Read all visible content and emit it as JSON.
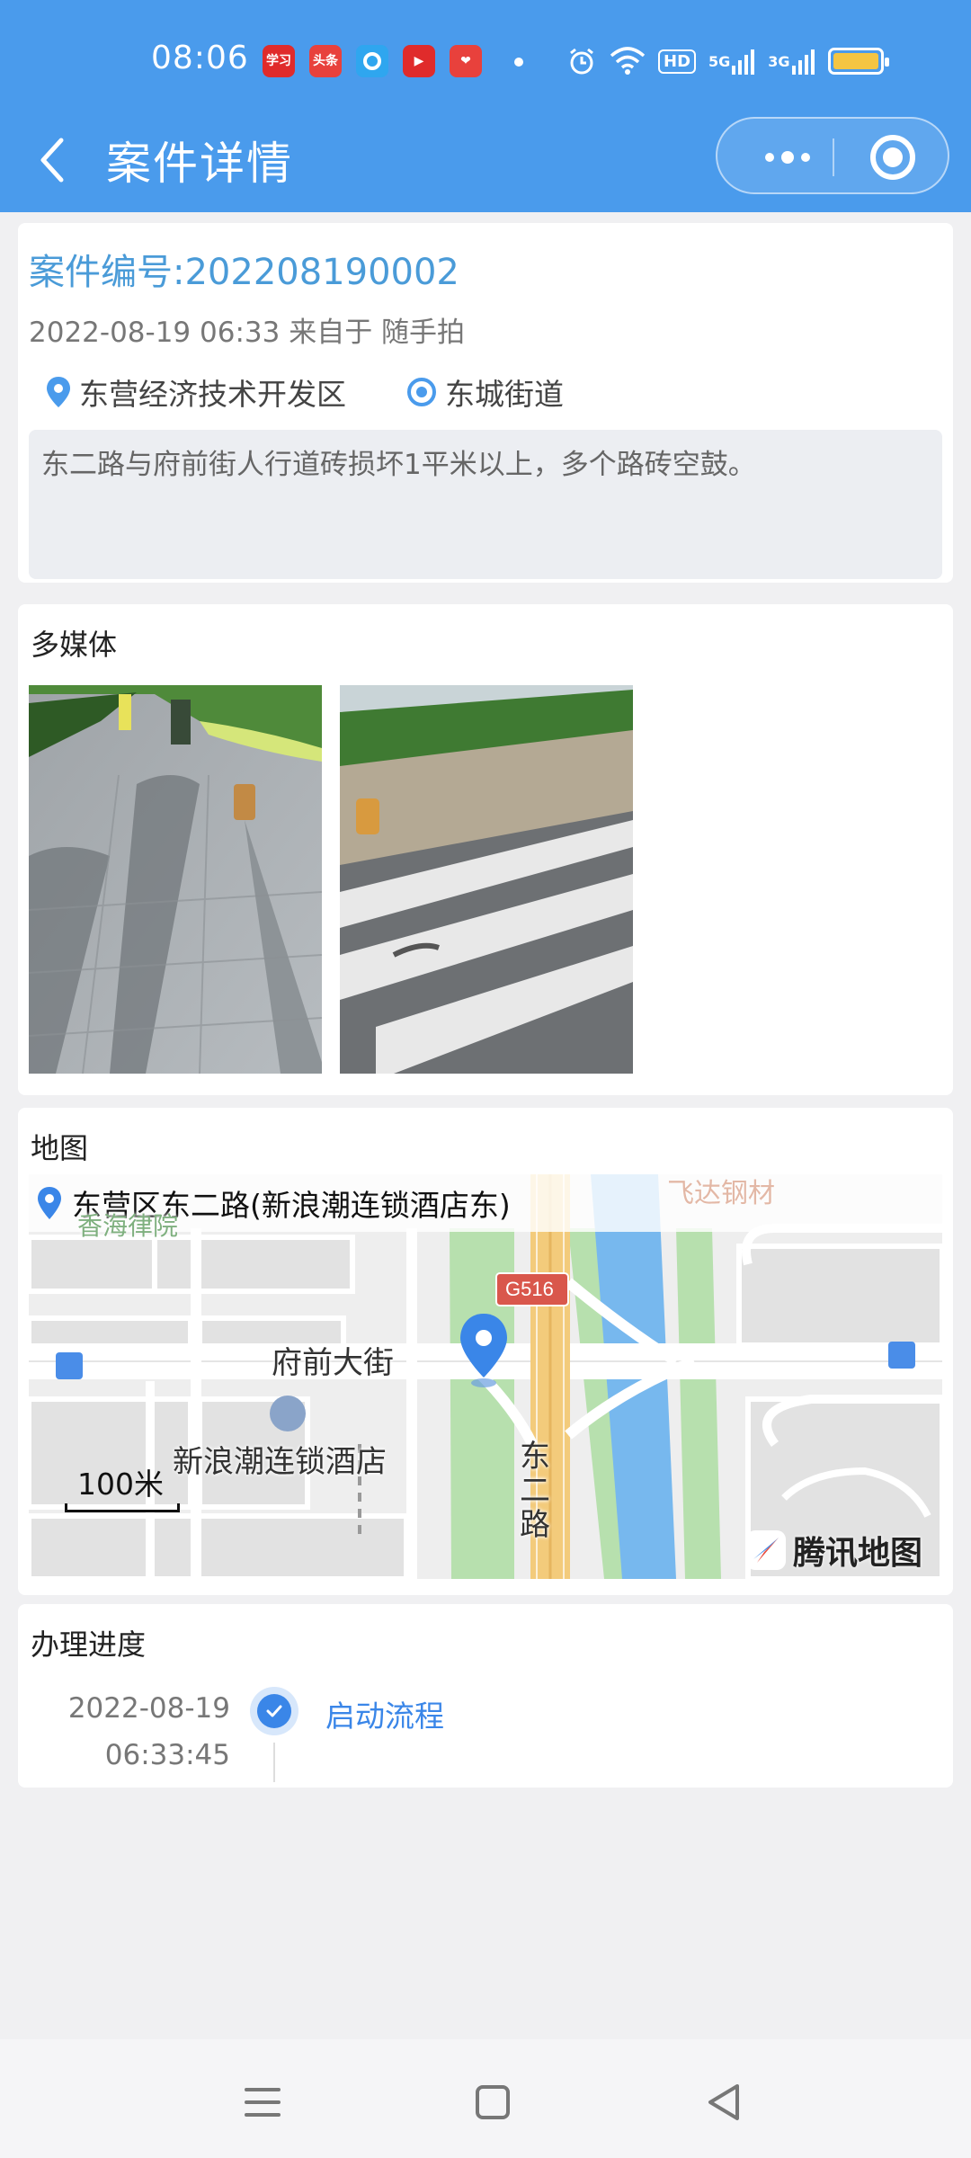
{
  "status_bar": {
    "time": "08:06",
    "app_icons": [
      {
        "name": "xuexi-icon",
        "text": "学习",
        "color": "#e02b2b"
      },
      {
        "name": "toutiao-icon",
        "text": "头条",
        "color": "#e8413c"
      },
      {
        "name": "app-blue-icon",
        "text": "",
        "color": "#2fa6ef"
      },
      {
        "name": "video-icon",
        "text": "▶",
        "color": "#e02b2b"
      },
      {
        "name": "heart-app-icon",
        "text": "❤",
        "color": "#e8413c"
      }
    ],
    "hd_label": "HD",
    "net_5g": "5G",
    "net_3g": "3G",
    "battery_color": "#f4c542"
  },
  "nav": {
    "title": "案件详情"
  },
  "case": {
    "title": "案件编号:202208190002",
    "meta": "2022-08-19 06:33 来自于 随手拍",
    "district": "东营经济技术开发区",
    "street": "东城街道",
    "description": "东二路与府前街人行道砖损坏1平米以上，多个路砖空鼓。"
  },
  "media": {
    "title": "多媒体"
  },
  "map": {
    "title": "地图",
    "address": "东营区东二路(新浪潮连锁酒店东)",
    "labels": {
      "road_fuqian": "府前大街",
      "hotel": "新浪潮连锁酒店",
      "road_dong1": "东",
      "road_dong2": "二",
      "road_dong3": "路",
      "highway": "G516",
      "feida": "飞达钢材",
      "top_left": "香海律院"
    },
    "scale": "100米",
    "logo": "腾讯地图"
  },
  "progress": {
    "title": "办理进度",
    "steps": [
      {
        "date": "2022-08-19",
        "time": "06:33:45",
        "label": "启动流程"
      }
    ]
  }
}
